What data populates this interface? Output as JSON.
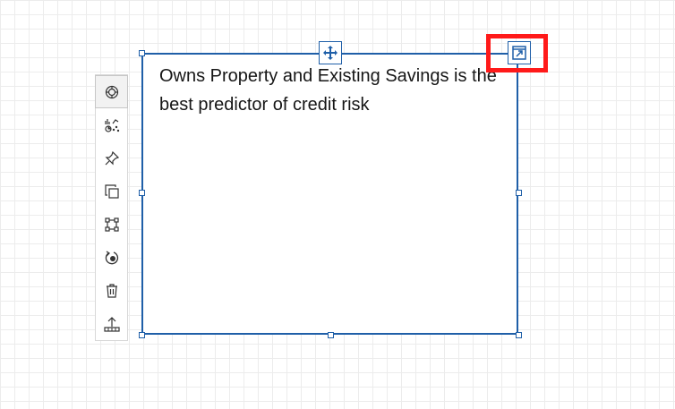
{
  "card": {
    "title": "Owns Property and Existing Savings is the best predictor of credit risk"
  },
  "icons": {
    "move": "move-arrows-icon",
    "expand": "expand-launch-icon"
  },
  "toolbar": {
    "items": [
      {
        "name": "radar-target-icon",
        "active": true
      },
      {
        "name": "chart-types-icon",
        "active": false
      },
      {
        "name": "pin-icon",
        "active": false
      },
      {
        "name": "duplicate-icon",
        "active": false
      },
      {
        "name": "bounding-box-icon",
        "active": false
      },
      {
        "name": "rotate-insights-icon",
        "active": false
      },
      {
        "name": "trash-icon",
        "active": false
      },
      {
        "name": "upload-icon",
        "active": false
      }
    ]
  },
  "colors": {
    "accent": "#1f5fa8",
    "highlight": "#ff1a1a",
    "center": "#008571",
    "orange": "#f16c1c",
    "blue": "#6ea6e8",
    "ring_dots": "#008571"
  }
}
